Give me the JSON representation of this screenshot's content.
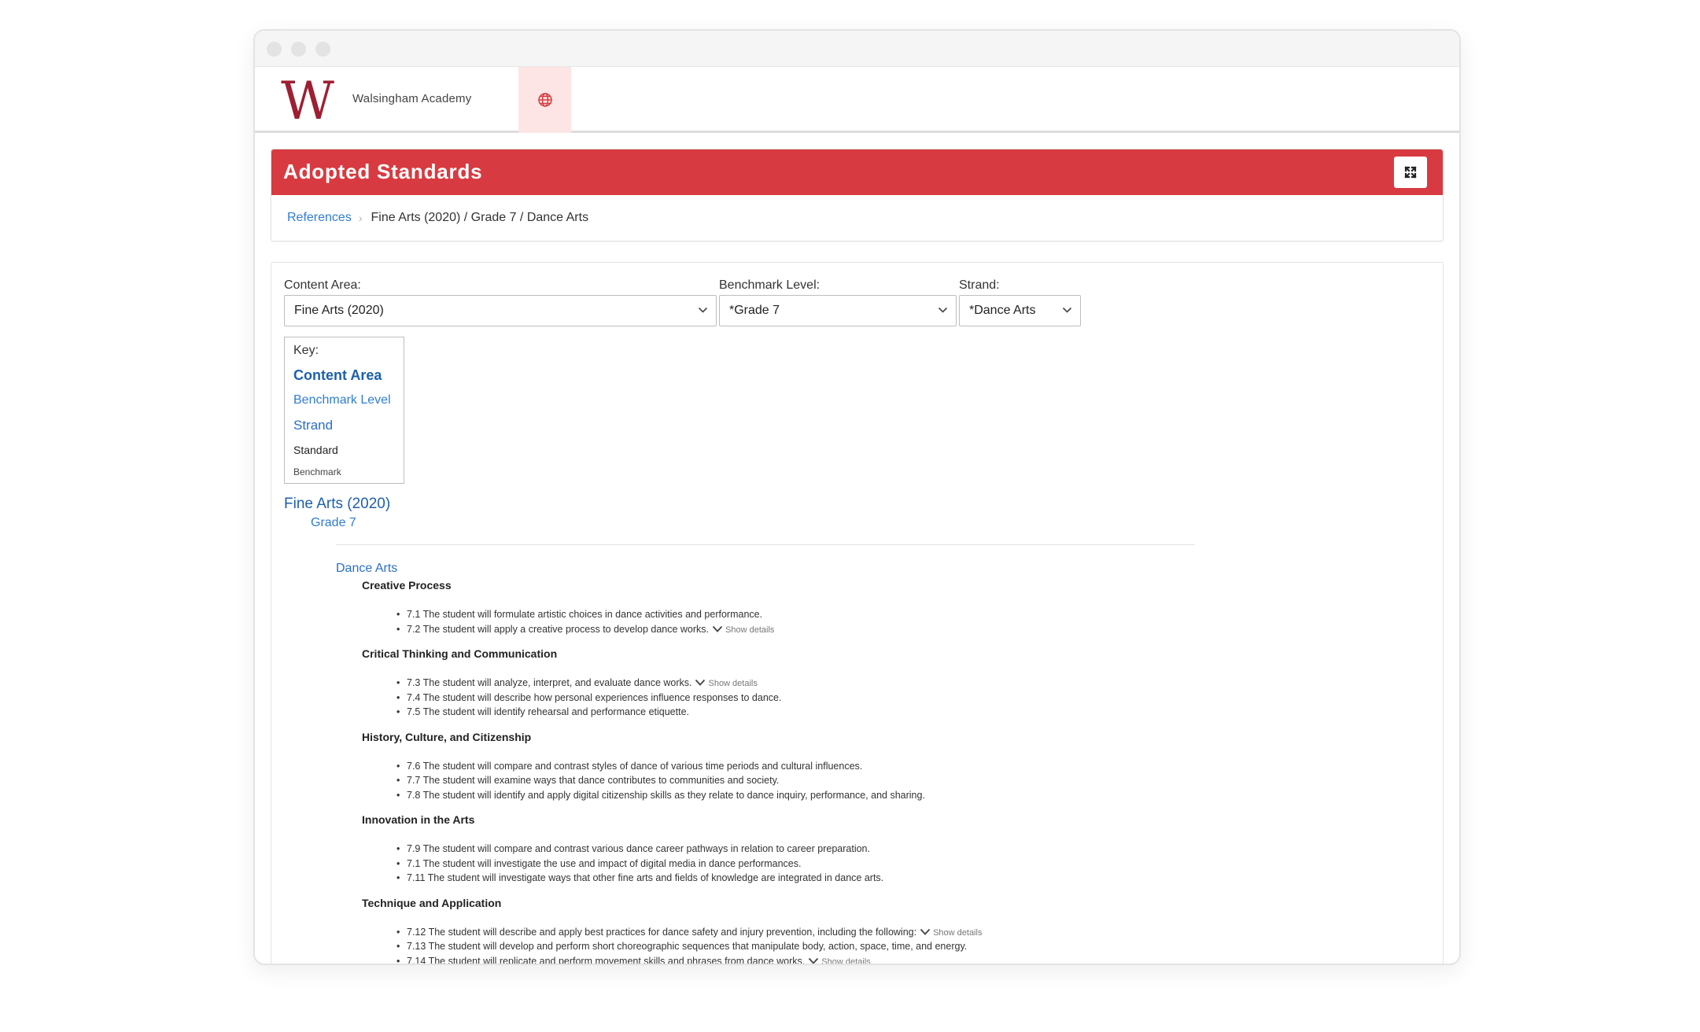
{
  "header": {
    "school_name": "Walsingham Academy",
    "logo_letter": "W",
    "brand_color": "#9e1f32",
    "globe_icon": "globe-icon"
  },
  "title_card": {
    "title": "Adopted Standards",
    "accent_color": "#d73b41",
    "expand_icon": "expand-icon",
    "breadcrumb": {
      "link": "References",
      "path": "Fine Arts (2020) / Grade 7 / Dance Arts"
    }
  },
  "filters": {
    "content_area": {
      "label": "Content Area:",
      "value": "Fine Arts (2020)"
    },
    "benchmark_level": {
      "label": "Benchmark Level:",
      "value": "*Grade 7"
    },
    "strand": {
      "label": "Strand:",
      "value": "*Dance Arts"
    }
  },
  "key": {
    "title": "Key:",
    "content_area": "Content Area",
    "benchmark_level": "Benchmark Level",
    "strand": "Strand",
    "standard": "Standard",
    "benchmark": "Benchmark"
  },
  "tree": {
    "content_area": "Fine Arts (2020)",
    "grade": "Grade 7",
    "strand": "Dance Arts",
    "show_details_label": "Show details",
    "standards": [
      {
        "title": "Creative Process",
        "benchmarks": [
          {
            "text": "7.1 The student will formulate artistic choices in dance activities and performance."
          },
          {
            "text": "7.2 The student will apply a creative process to develop dance works."
          }
        ]
      },
      {
        "title": "Critical Thinking and Communication",
        "benchmarks": [
          {
            "text": "7.3 The student will analyze, interpret, and evaluate dance works."
          },
          {
            "text": "7.4 The student will describe how personal experiences influence responses to dance."
          },
          {
            "text": "7.5 The student will identify rehearsal and performance etiquette."
          }
        ]
      },
      {
        "title": "History, Culture, and Citizenship",
        "benchmarks": [
          {
            "text": "7.6 The student will compare and contrast styles of dance of various time periods and cultural influences."
          },
          {
            "text": "7.7 The student will examine ways that dance contributes to communities and society."
          },
          {
            "text": "7.8 The student will identify and apply digital citizenship skills as they relate to dance inquiry, performance, and sharing."
          }
        ]
      },
      {
        "title": "Innovation in the Arts",
        "benchmarks": [
          {
            "text": "7.9 The student will compare and contrast various dance career pathways in relation to career preparation."
          },
          {
            "text": "7.1 The student will investigate the use and impact of digital media in dance performances."
          },
          {
            "text": "7.11 The student will investigate ways that other fine arts and fields of knowledge are integrated in dance arts."
          }
        ]
      },
      {
        "title": "Technique and Application",
        "benchmarks": [
          {
            "text": "7.12 The student will describe and apply best practices for dance safety and injury prevention, including the following:"
          },
          {
            "text": "7.13 The student will develop and perform short choreographic sequences that manipulate body, action, space, time, and energy."
          },
          {
            "text": "7.14 The student will replicate and perform movement skills and phrases from dance works."
          }
        ]
      }
    ]
  }
}
